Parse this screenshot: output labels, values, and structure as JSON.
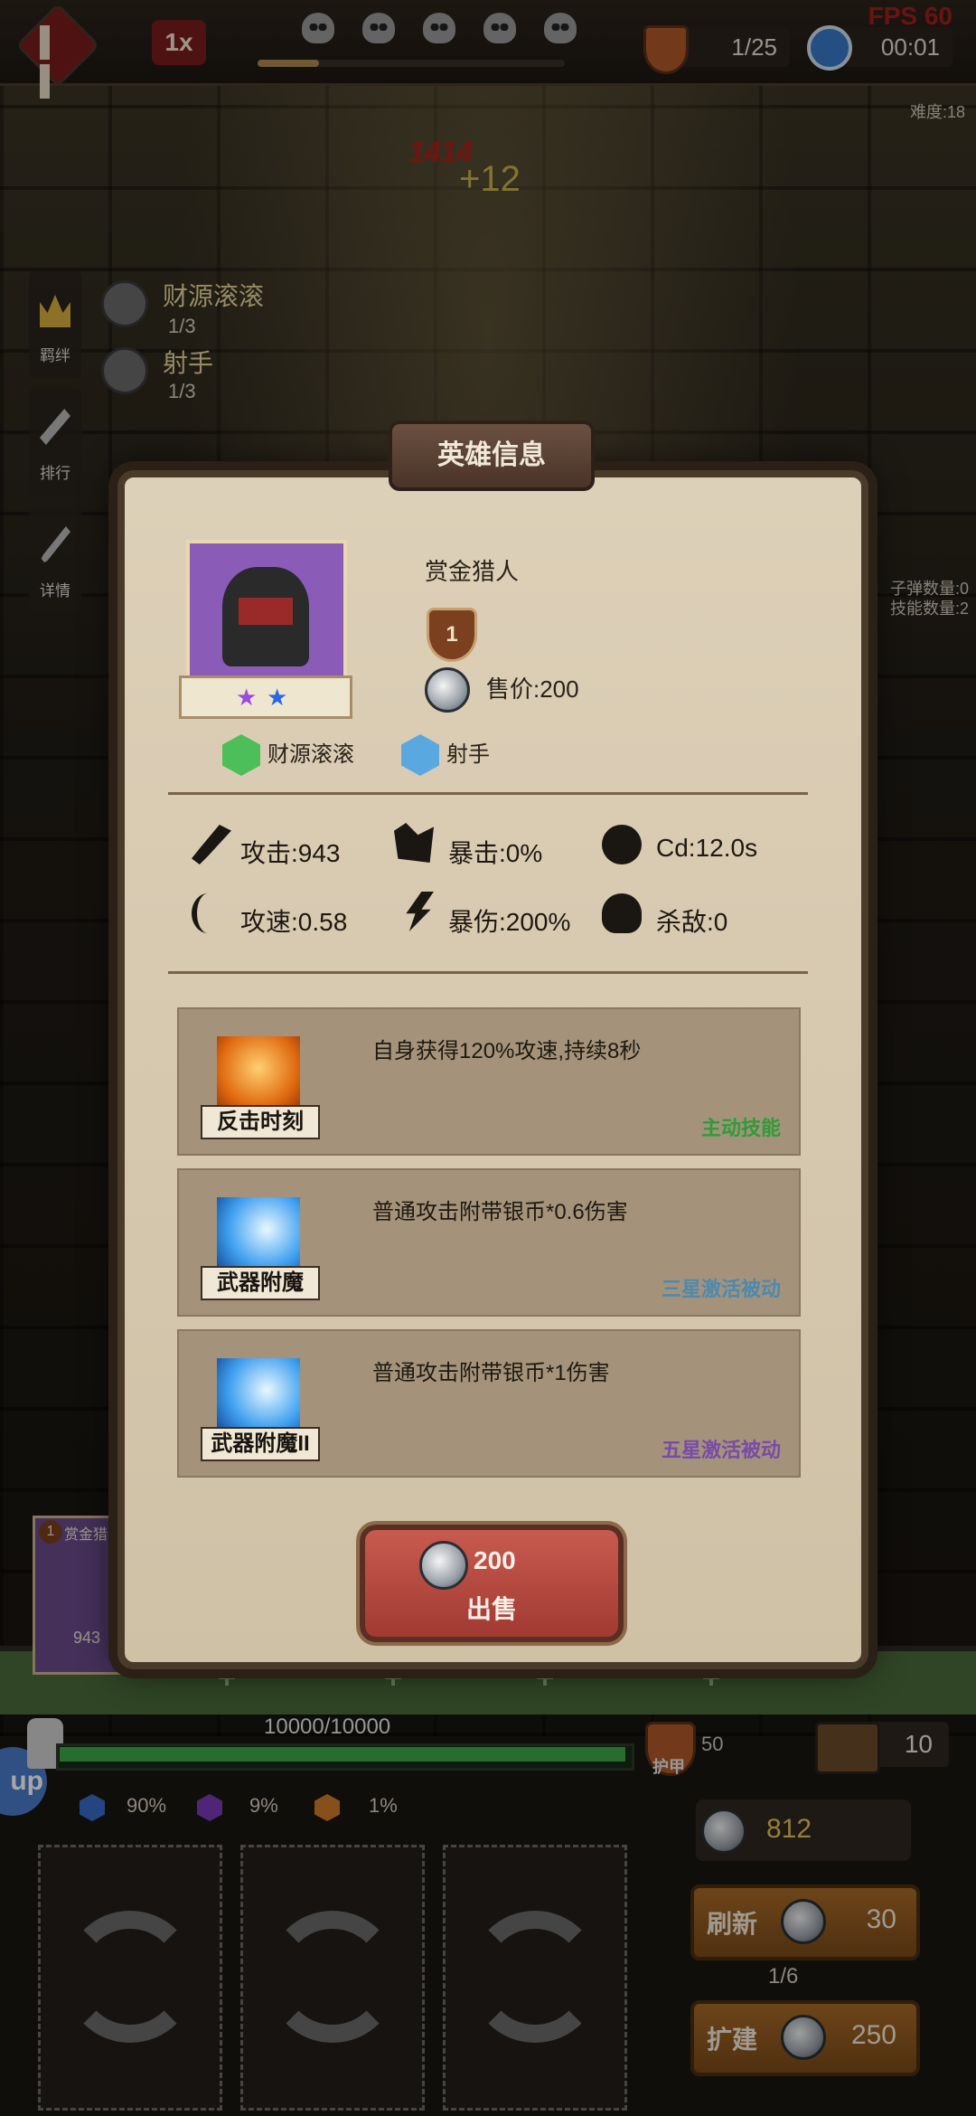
{
  "topbar": {
    "speed": "1x",
    "wave_progress": 0.2,
    "shield_count": "1/25",
    "timer": "00:01",
    "fps": "FPS 60",
    "difficulty": "难度:18",
    "bullet_count": "子弹数量:0",
    "skill_count": "技能数量:2"
  },
  "sidebar": {
    "items": [
      {
        "label": "羁绊",
        "icon": "crown-icon"
      },
      {
        "label": "排行",
        "icon": "sword-icon"
      },
      {
        "label": "详情",
        "icon": "wand-icon"
      }
    ]
  },
  "bonds": [
    {
      "name": "财源滚滚",
      "count": "1/3",
      "icon": "coin-pile-icon"
    },
    {
      "name": "射手",
      "count": "1/3",
      "icon": "arrow-icon"
    }
  ],
  "combat": {
    "damage": "1414",
    "gain": "+12"
  },
  "panel": {
    "title": "英雄信息",
    "hero": {
      "name": "赏金猎人",
      "level": "1",
      "price": "售价:200",
      "stars": [
        "purple",
        "blue"
      ],
      "traits": [
        {
          "label": "财源滚滚",
          "color": "#4cbf5a"
        },
        {
          "label": "射手",
          "color": "#5aa8e0"
        }
      ]
    },
    "stats": {
      "attack": "攻击:943",
      "crit": "暴击:0%",
      "cd": "Cd:12.0s",
      "attack_speed": "攻速:0.58",
      "crit_damage": "暴伤:200%",
      "kills": "杀敌:0"
    },
    "skills": [
      {
        "name": "反击时刻",
        "desc": "自身获得120%攻速,持续8秒",
        "type": "主动技能",
        "type_color": "#2e9c3a"
      },
      {
        "name": "武器附魔",
        "desc": "普通攻击附带银币*0.6伤害",
        "type": "三星激活被动",
        "type_color": "#4a8ab0"
      },
      {
        "name": "武器附魔II",
        "desc": "普通攻击附带银币*1伤害",
        "type": "五星激活被动",
        "type_color": "#7a4aa8"
      }
    ],
    "sell": {
      "price": "200",
      "label": "出售"
    }
  },
  "board": {
    "mini_card": {
      "name": "赏金猎人",
      "level": "1",
      "attack": "943"
    }
  },
  "hud": {
    "hp": "10000/10000",
    "hp_fraction": 1.0,
    "armor_label": "护甲",
    "armor_value": "50",
    "chest_count": "10",
    "rates": [
      {
        "value": "90%",
        "color": "#3a6ac8"
      },
      {
        "value": "9%",
        "color": "#7a3ab8"
      },
      {
        "value": "1%",
        "color": "#d07a28"
      }
    ],
    "silver": "812",
    "refresh_label": "刷新",
    "refresh_cost": "30",
    "refresh_count": "1/6",
    "expand_label": "扩建",
    "expand_cost": "250",
    "up_badge": "up"
  }
}
